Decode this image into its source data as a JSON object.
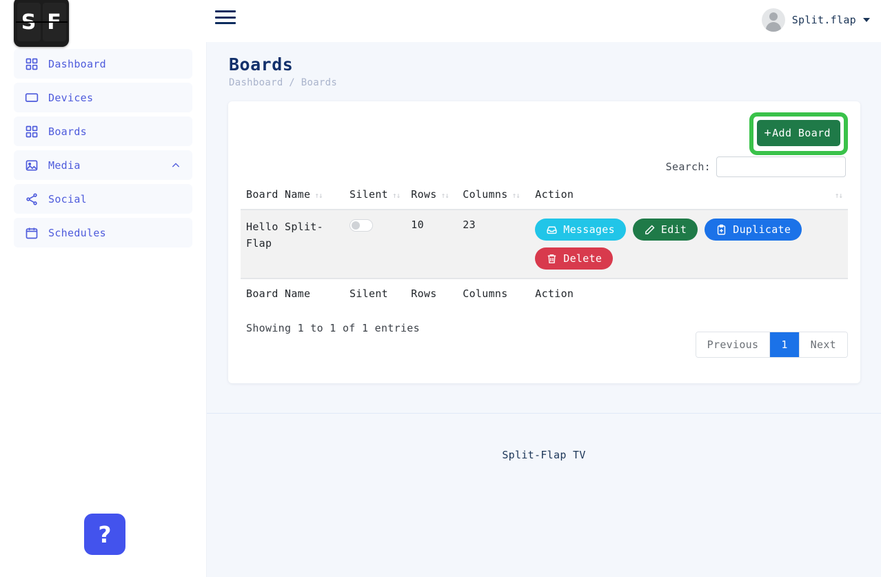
{
  "brand": {
    "logo_left": "S",
    "logo_right": "F",
    "accent_blue": "#4e5bdc",
    "accent_green": "#1f7a48",
    "highlight_green": "#3ac24a"
  },
  "topbar": {
    "menu_icon": "hamburger-icon",
    "user": {
      "name": "Split.flap",
      "avatar_icon": "user-avatar-icon",
      "caret_icon": "caret-down-icon"
    }
  },
  "sidebar": {
    "items": [
      {
        "label": "Dashboard",
        "icon": "grid-icon",
        "expandable": false
      },
      {
        "label": "Devices",
        "icon": "monitor-icon",
        "expandable": false
      },
      {
        "label": "Boards",
        "icon": "grid-icon",
        "expandable": false
      },
      {
        "label": "Media",
        "icon": "image-icon",
        "expandable": true,
        "chevron": "chevron-up-icon"
      },
      {
        "label": "Social",
        "icon": "share-icon",
        "expandable": false
      },
      {
        "label": "Schedules",
        "icon": "calendar-icon",
        "expandable": false
      }
    ],
    "help_button": "?"
  },
  "page": {
    "title": "Boards",
    "breadcrumb": "Dashboard / Boards"
  },
  "toolbar": {
    "add_board_plus": "+",
    "add_board_label": "Add Board",
    "highlighted": true
  },
  "search": {
    "label": "Search:",
    "value": "",
    "placeholder": ""
  },
  "table": {
    "headers": [
      {
        "label": "Board Name",
        "sortable": true,
        "sort_icon": "↑↓"
      },
      {
        "label": "Silent",
        "sortable": true,
        "sort_icon": "↑↓"
      },
      {
        "label": "Rows",
        "sortable": true,
        "sort_icon": "↑↓"
      },
      {
        "label": "Columns",
        "sortable": true,
        "sort_icon": "↑↓"
      },
      {
        "label": "Action",
        "sortable": false,
        "sort_icon": ""
      },
      {
        "label": "",
        "sortable": true,
        "sort_icon": "↑↓"
      }
    ],
    "footers": [
      "Board Name",
      "Silent",
      "Rows",
      "Columns",
      "Action"
    ],
    "rows": [
      {
        "name": "Hello Split-Flap",
        "silent": false,
        "rows": "10",
        "columns": "23",
        "actions": [
          {
            "label": "Messages",
            "icon": "inbox-icon",
            "style": "messages"
          },
          {
            "label": "Edit",
            "icon": "pencil-icon",
            "style": "edit"
          },
          {
            "label": "Duplicate",
            "icon": "clipboard-plus-icon",
            "style": "duplicate"
          },
          {
            "label": "Delete",
            "icon": "trash-icon",
            "style": "delete"
          }
        ]
      }
    ]
  },
  "info": {
    "showing": "Showing 1 to 1 of 1 entries"
  },
  "pagination": {
    "previous": "Previous",
    "pages": [
      "1"
    ],
    "active_page": "1",
    "next": "Next"
  },
  "footer": {
    "text": "Split-Flap TV"
  }
}
